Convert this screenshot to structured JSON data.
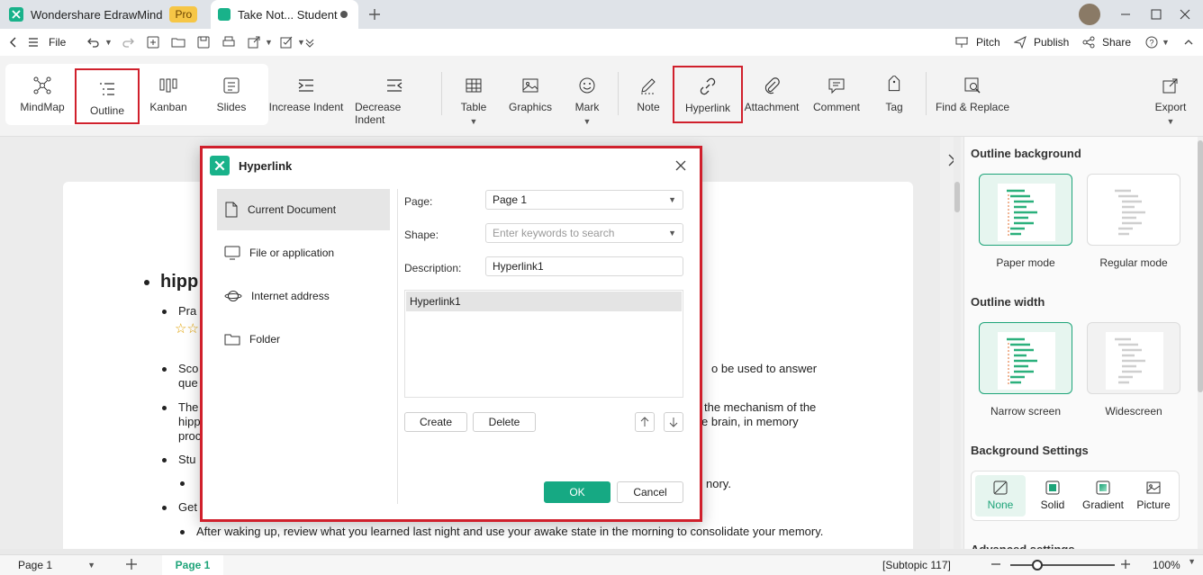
{
  "titlebar": {
    "app_name": "Wondershare EdrawMind",
    "pro_badge": "Pro",
    "doc_tab": "Take Not... Student"
  },
  "menubar": {
    "file": "File",
    "pitch": "Pitch",
    "publish": "Publish",
    "share": "Share"
  },
  "ribbon": {
    "mindmap": "MindMap",
    "outline": "Outline",
    "kanban": "Kanban",
    "slides": "Slides",
    "increase_indent": "Increase Indent",
    "decrease_indent": "Decrease Indent",
    "table": "Table",
    "graphics": "Graphics",
    "mark": "Mark",
    "note": "Note",
    "hyperlink": "Hyperlink",
    "attachment": "Attachment",
    "comment": "Comment",
    "tag": "Tag",
    "find_replace": "Find & Replace",
    "export": "Export"
  },
  "outline": {
    "heading": "hipp",
    "l1": "Pra",
    "l2a": "Sco",
    "l2a_right": "o be used to answer",
    "l2b": "que",
    "l3a": "The",
    "l3a_right": "the mechanism of the",
    "l3b": "hipp",
    "l3b_right": "e brain, in memory",
    "l3c": "proc",
    "l4": "Stu",
    "l4_right": "nory.",
    "l5": "Get",
    "l6": "After waking up, review what you learned last night and use your awake state in the morning to consolidate your memory."
  },
  "dialog": {
    "title": "Hyperlink",
    "nav": [
      "Current Document",
      "File or application",
      "Internet address",
      "Folder"
    ],
    "page_label": "Page:",
    "page_value": "Page 1",
    "shape_label": "Shape:",
    "shape_placeholder": "Enter keywords to search",
    "description_label": "Description:",
    "description_value": "Hyperlink1",
    "list_items": [
      "Hyperlink1"
    ],
    "create": "Create",
    "delete": "Delete",
    "ok": "OK",
    "cancel": "Cancel"
  },
  "rpanel": {
    "outline_background": "Outline background",
    "paper_mode": "Paper mode",
    "regular_mode": "Regular mode",
    "outline_width": "Outline width",
    "narrow_screen": "Narrow screen",
    "widescreen": "Widescreen",
    "background_settings": "Background Settings",
    "bg_none": "None",
    "bg_solid": "Solid",
    "bg_gradient": "Gradient",
    "bg_picture": "Picture",
    "advanced_settings": "Advanced settings"
  },
  "status": {
    "page_select": "Page 1",
    "page_tab": "Page 1",
    "subtopic": "[Subtopic 117]",
    "zoom": "100%"
  },
  "colors": {
    "accent": "#19b28a",
    "highlight_border": "#d0202c"
  }
}
